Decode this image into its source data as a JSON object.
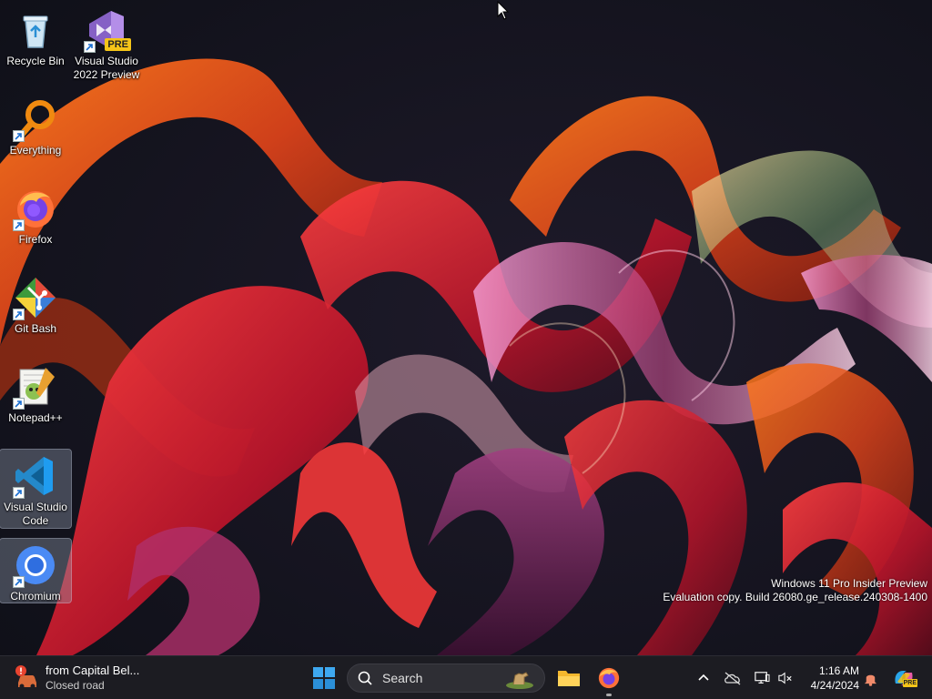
{
  "desktop": {
    "icons": [
      {
        "label": "Recycle Bin",
        "icon": "recycle-bin-icon"
      },
      {
        "label": "Visual Studio\n2022 Preview",
        "icon": "visual-studio-icon",
        "badge": "PRE"
      },
      {
        "label": "Everything",
        "icon": "everything-search-icon"
      },
      {
        "label": "Firefox",
        "icon": "firefox-icon"
      },
      {
        "label": "Git Bash",
        "icon": "git-bash-icon"
      },
      {
        "label": "Notepad++",
        "icon": "notepad-plus-plus-icon"
      },
      {
        "label": "Visual Studio\nCode",
        "icon": "vscode-icon",
        "selected": true
      },
      {
        "label": "Chromium",
        "icon": "chromium-icon",
        "selected": true
      }
    ],
    "watermark": {
      "line1": "Windows 11 Pro Insider Preview",
      "line2": "Evaluation copy. Build 26080.ge_release.240308-1400"
    }
  },
  "taskbar": {
    "widget": {
      "title": "from Capital Bel...",
      "subtitle": "Closed road",
      "icon": "traffic-alert-icon"
    },
    "start": {
      "icon": "windows-start-icon"
    },
    "search": {
      "placeholder": "Search",
      "icon": "search-icon"
    },
    "apps": [
      {
        "name": "File Explorer",
        "icon": "file-explorer-icon",
        "running": false
      },
      {
        "name": "Firefox",
        "icon": "firefox-icon",
        "running": true
      }
    ],
    "tray": {
      "icons": [
        "chevron-up-icon",
        "onedrive-offline-icon",
        "network-icon",
        "volume-muted-icon",
        "notification-bell-icon",
        "copilot-icon"
      ],
      "copilot_badge": "PRE",
      "time": "1:16 AM",
      "date": "4/24/2024"
    }
  },
  "colors": {
    "taskbar_bg": "#1c1c22",
    "wallpaper_bg": "#14141f",
    "ribbon_orange": "#e0561a",
    "ribbon_red": "#c41c28",
    "ribbon_pink": "#e37ab0"
  }
}
